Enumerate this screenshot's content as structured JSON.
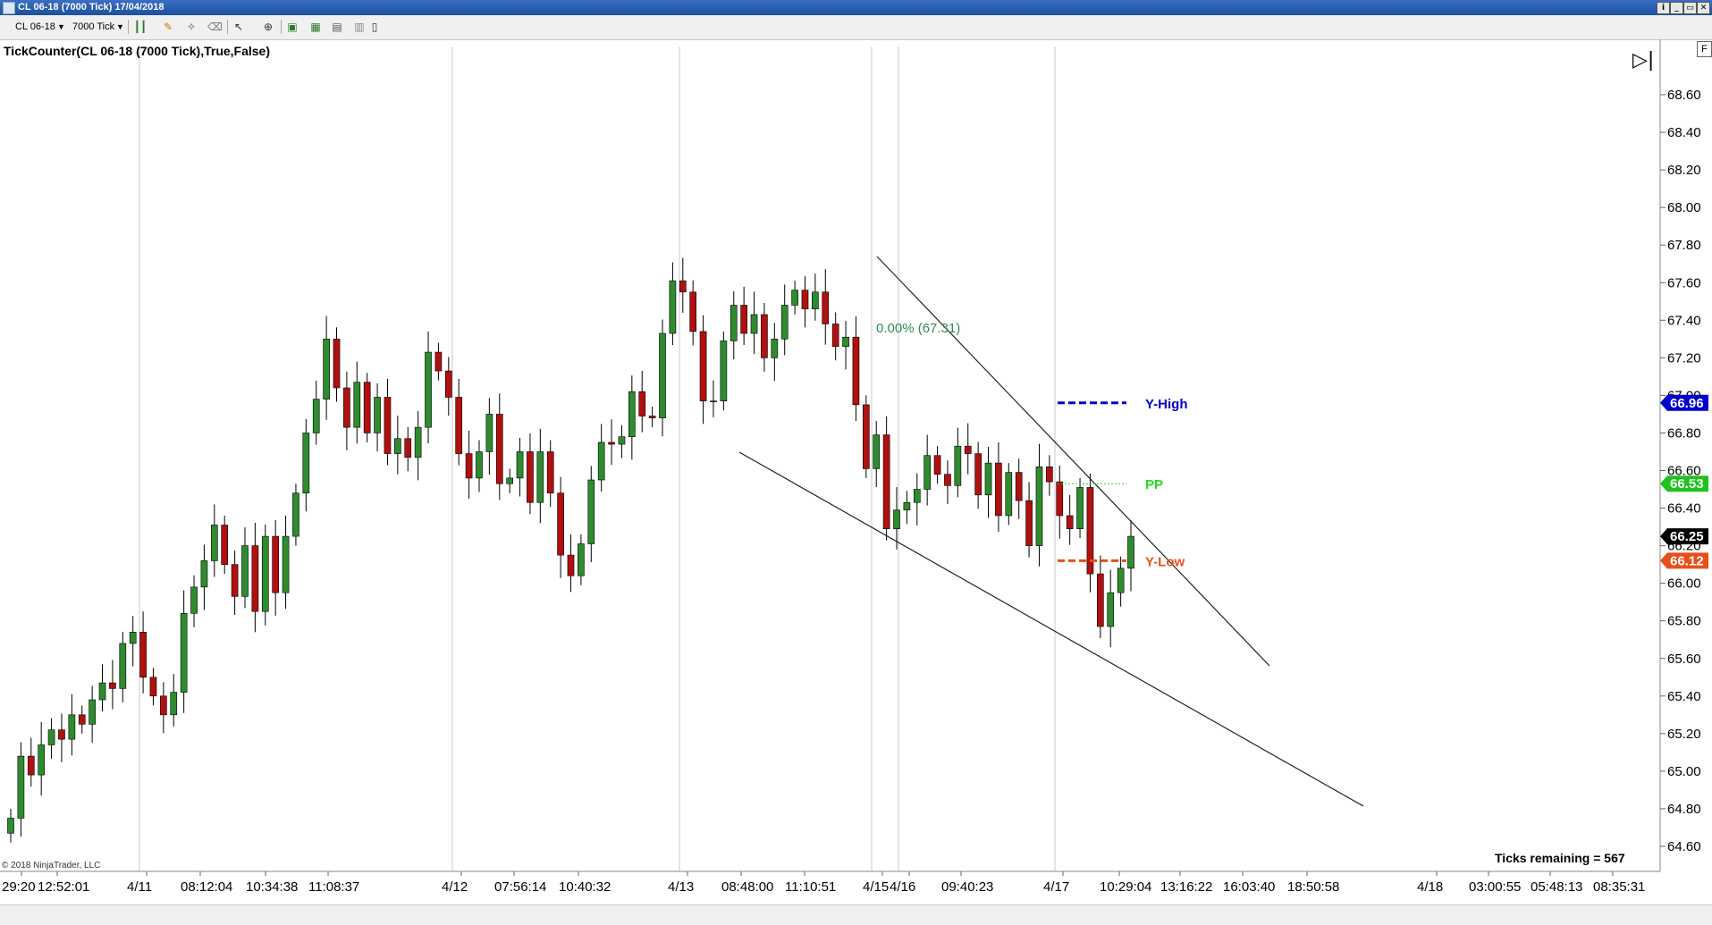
{
  "window": {
    "title": "CL 06-18 (7000 Tick)  17/04/2018",
    "buttons": [
      "i",
      "_",
      "▭",
      "✕"
    ]
  },
  "toolbar": {
    "instrument": "CL 06-18",
    "period": "7000 Tick"
  },
  "indicator_label": "TickCounter(CL 06-18 (7000 Tick),True,False)",
  "copyright": "© 2018 NinjaTrader, LLC",
  "ticks_remaining": "Ticks remaining = 567",
  "panel_button": "F",
  "chart_data": {
    "type": "candlestick",
    "ylim": [
      64.5,
      68.9
    ],
    "y_ticks": [
      "68.60",
      "68.40",
      "68.20",
      "68.00",
      "67.80",
      "67.60",
      "67.40",
      "67.20",
      "67.00",
      "66.80",
      "66.60",
      "66.40",
      "66.20",
      "66.00",
      "65.80",
      "65.60",
      "65.40",
      "65.20",
      "65.00",
      "64.80",
      "64.60"
    ],
    "x_labels": [
      "29:20",
      "12:52:01",
      "4/11",
      "08:12:04",
      "10:34:38",
      "11:08:37",
      "4/12",
      "07:56:14",
      "10:40:32",
      "4/13",
      "08:48:00",
      "11:10:51",
      "4/15",
      "4/16",
      "09:40:23",
      "4/17",
      "10:29:04",
      "13:16:22",
      "16:03:40",
      "18:50:58",
      "4/18",
      "03:00:55",
      "05:48:13",
      "08:35:31"
    ],
    "price_tags": [
      {
        "label": "66.96",
        "value": 66.96,
        "color": "#0000cc"
      },
      {
        "label": "66.53",
        "value": 66.53,
        "color": "#1fc21f"
      },
      {
        "label": "66.25",
        "value": 66.25,
        "color": "#000000"
      },
      {
        "label": "66.12",
        "value": 66.12,
        "color": "#e8501a"
      }
    ],
    "levels": [
      {
        "name": "Y-High",
        "value": 66.96,
        "color": "#0000cc"
      },
      {
        "name": "PP",
        "value": 66.53,
        "color": "#22dd22"
      },
      {
        "name": "Y-Low",
        "value": 66.12,
        "color": "#e8501a"
      }
    ],
    "fib_label": "0.00% (67.31)",
    "bull_color": "#2e8b2e",
    "bear_color": "#b01010",
    "closes": [
      64.75,
      65.08,
      64.98,
      65.14,
      65.22,
      65.17,
      65.3,
      65.25,
      65.38,
      65.47,
      65.44,
      65.68,
      65.74,
      65.5,
      65.4,
      65.3,
      65.42,
      65.84,
      65.98,
      66.12,
      66.31,
      66.1,
      65.93,
      66.2,
      65.85,
      66.25,
      65.95,
      66.25,
      66.48,
      66.8,
      66.98,
      67.3,
      67.04,
      66.83,
      67.07,
      66.8,
      66.99,
      66.69,
      66.77,
      66.67,
      66.83,
      67.23,
      67.13,
      66.99,
      66.69,
      66.56,
      66.7,
      66.9,
      66.53,
      66.56,
      66.7,
      66.43,
      66.7,
      66.48,
      66.15,
      66.04,
      66.21,
      66.55,
      66.75,
      66.74,
      66.78,
      67.02,
      66.89,
      66.88,
      67.33,
      67.61,
      67.55,
      67.34,
      66.97,
      66.97,
      67.29,
      67.48,
      67.33,
      67.43,
      67.2,
      67.3,
      67.48,
      67.56,
      67.46,
      67.55,
      67.38,
      67.26,
      67.31,
      66.95,
      66.61,
      66.79,
      66.29,
      66.39,
      66.43,
      66.5,
      66.68,
      66.58,
      66.52,
      66.73,
      66.69,
      66.47,
      66.64,
      66.36,
      66.59,
      66.44,
      66.2,
      66.62,
      66.54,
      66.36,
      66.29,
      66.51,
      66.05,
      65.77,
      65.95,
      66.08,
      66.25
    ]
  }
}
